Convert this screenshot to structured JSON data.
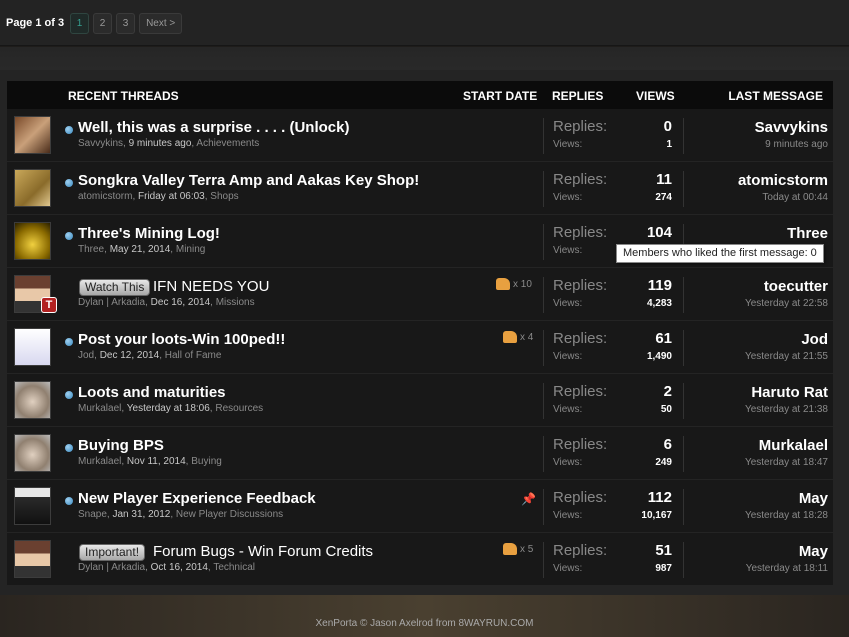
{
  "pagination": {
    "label": "Page 1 of 3",
    "pages": [
      "1",
      "2",
      "3"
    ],
    "current": "1",
    "next": "Next >"
  },
  "headers": {
    "threads": "RECENT THREADS",
    "start_date": "START DATE",
    "replies": "REPLIES",
    "views": "VIEWS",
    "last_message": "LAST MESSAGE"
  },
  "stat_labels": {
    "replies": "Replies:",
    "views": "Views:"
  },
  "threads": [
    {
      "title": "Well, this was a surprise . . . . (Unlock)",
      "author": "Savvykins",
      "date": "9 minutes ago",
      "forum": "Achievements",
      "replies": "0",
      "views": "1",
      "last_user": "Savvykins",
      "last_time": "9 minutes ago",
      "avatar": "brown-hair-portrait"
    },
    {
      "title": "Songkra Valley Terra Amp and Aakas Key Shop!",
      "author": "atomicstorm",
      "date": "Friday at 06:03",
      "forum": "Shops",
      "replies": "11",
      "views": "274",
      "last_user": "atomicstorm",
      "last_time": "Today at 00:44",
      "avatar": "sand-creature"
    },
    {
      "title": "Three's Mining Log!",
      "author": "Three",
      "date": "May 21, 2014",
      "forum": "Mining",
      "replies": "104",
      "views": "",
      "last_user": "Three",
      "last_time": "",
      "avatar": "gold-orb"
    },
    {
      "prefix": "Watch This",
      "title": "IFN NEEDS YOU",
      "author": "Dylan",
      "author2": "Arkadia",
      "date": "Dec 16, 2014",
      "forum": "Missions",
      "likes": "x 10",
      "replies": "119",
      "views": "4,283",
      "last_user": "toecutter",
      "last_time": "Yesterday at 22:58",
      "avatar": "anime-boy",
      "badge": "T"
    },
    {
      "title": "Post your loots-Win 100ped!!",
      "author": "Jod",
      "date": "Dec 12, 2014",
      "forum": "Hall of Fame",
      "likes": "x 4",
      "replies": "61",
      "views": "1,490",
      "last_user": "Jod",
      "last_time": "Yesterday at 21:55",
      "avatar": "kangaroo"
    },
    {
      "title": "Loots and maturities",
      "author": "Murkalael",
      "date": "Yesterday at 18:06",
      "forum": "Resources",
      "replies": "2",
      "views": "50",
      "last_user": "Haruto Rat",
      "last_time": "Yesterday at 21:38",
      "avatar": "old-man-face"
    },
    {
      "title": "Buying BPS",
      "author": "Murkalael",
      "date": "Nov 11, 2014",
      "forum": "Buying",
      "replies": "6",
      "views": "249",
      "last_user": "Murkalael",
      "last_time": "Yesterday at 18:47",
      "avatar": "old-man-face"
    },
    {
      "title": "New Player Experience Feedback",
      "author": "Snape",
      "date": "Jan 31, 2012",
      "forum": "New Player Discussions",
      "pinned": true,
      "replies": "112",
      "views": "10,167",
      "last_user": "May",
      "last_time": "Yesterday at 18:28",
      "avatar": "dark-robed"
    },
    {
      "prefix": "Important!",
      "title": "Forum Bugs - Win Forum Credits",
      "author": "Dylan",
      "author2": "Arkadia",
      "date": "Oct 16, 2014",
      "forum": "Technical",
      "likes": "x 5",
      "replies": "51",
      "views": "987",
      "last_user": "May",
      "last_time": "Yesterday at 18:11",
      "avatar": "anime-boy"
    }
  ],
  "tooltip": "Members who liked the first message: 0",
  "footer": "XenPorta © Jason Axelrod from 8WAYRUN.COM"
}
